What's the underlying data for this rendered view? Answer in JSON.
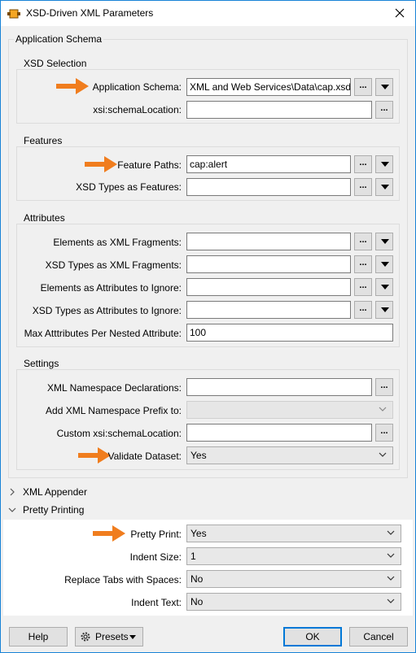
{
  "window": {
    "title": "XSD-Driven XML Parameters"
  },
  "application_schema": {
    "title": "Application Schema",
    "xsd_selection": {
      "title": "XSD Selection",
      "application_schema_label": "Application Schema:",
      "application_schema_value": "XML and Web Services\\Data\\cap.xsd\"",
      "schema_location_label": "xsi:schemaLocation:",
      "schema_location_value": ""
    },
    "features": {
      "title": "Features",
      "feature_paths_label": "Feature Paths:",
      "feature_paths_value": "cap:alert",
      "xsd_types_label": "XSD Types as Features:",
      "xsd_types_value": ""
    },
    "attributes": {
      "title": "Attributes",
      "elements_xml_label": "Elements as XML Fragments:",
      "elements_xml_value": "",
      "xsd_types_xml_label": "XSD Types as XML Fragments:",
      "xsd_types_xml_value": "",
      "elements_ignore_label": "Elements as Attributes to Ignore:",
      "elements_ignore_value": "",
      "xsd_types_ignore_label": "XSD Types as Attributes to Ignore:",
      "xsd_types_ignore_value": "",
      "max_attributes_label": "Max Atttributes Per Nested Attribute:",
      "max_attributes_value": "100"
    },
    "settings": {
      "title": "Settings",
      "namespace_decl_label": "XML Namespace Declarations:",
      "namespace_decl_value": "",
      "add_prefix_label": "Add XML Namespace Prefix to:",
      "add_prefix_value": "",
      "custom_location_label": "Custom xsi:schemaLocation:",
      "custom_location_value": "",
      "validate_label": "Validate Dataset:",
      "validate_value": "Yes"
    }
  },
  "xml_appender": {
    "title": "XML Appender"
  },
  "pretty_printing": {
    "title": "Pretty Printing",
    "pretty_print_label": "Pretty Print:",
    "pretty_print_value": "Yes",
    "indent_size_label": "Indent Size:",
    "indent_size_value": "1",
    "replace_tabs_label": "Replace Tabs with Spaces:",
    "replace_tabs_value": "No",
    "indent_text_label": "Indent Text:",
    "indent_text_value": "No"
  },
  "buttons": {
    "ellipsis": "...",
    "help": "Help",
    "presets": "Presets",
    "ok": "OK",
    "cancel": "Cancel"
  },
  "colors": {
    "accent": "#0078d7",
    "annotation_arrow": "#f07d1e",
    "window_border": "#1883d7"
  },
  "icons": {
    "title_icon": "fme-transformer-icon",
    "close": "close-icon",
    "arrow": "orange-right-arrow-icon",
    "presets": "gear-icon"
  }
}
